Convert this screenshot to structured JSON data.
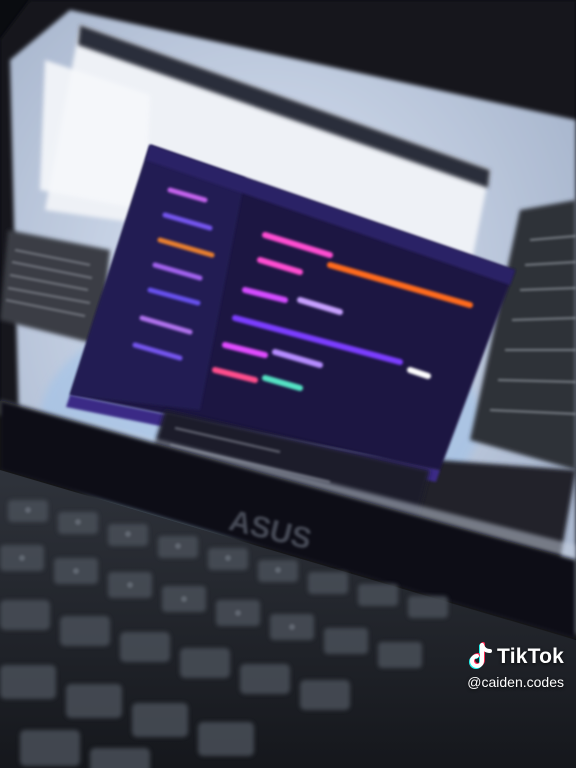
{
  "photo": {
    "subject": "photo of a laptop screen showing a code editor"
  },
  "watermark": {
    "brand": "TikTok",
    "handle": "@caiden.codes",
    "icon": "tiktok-note-icon"
  },
  "laptop": {
    "logo_text": "ASUS"
  },
  "colors": {
    "editor_bg": "#1b1742",
    "accent_purple": "#7b3cff",
    "accent_orange": "#ff6a1a",
    "keyboard": "#23262d"
  }
}
